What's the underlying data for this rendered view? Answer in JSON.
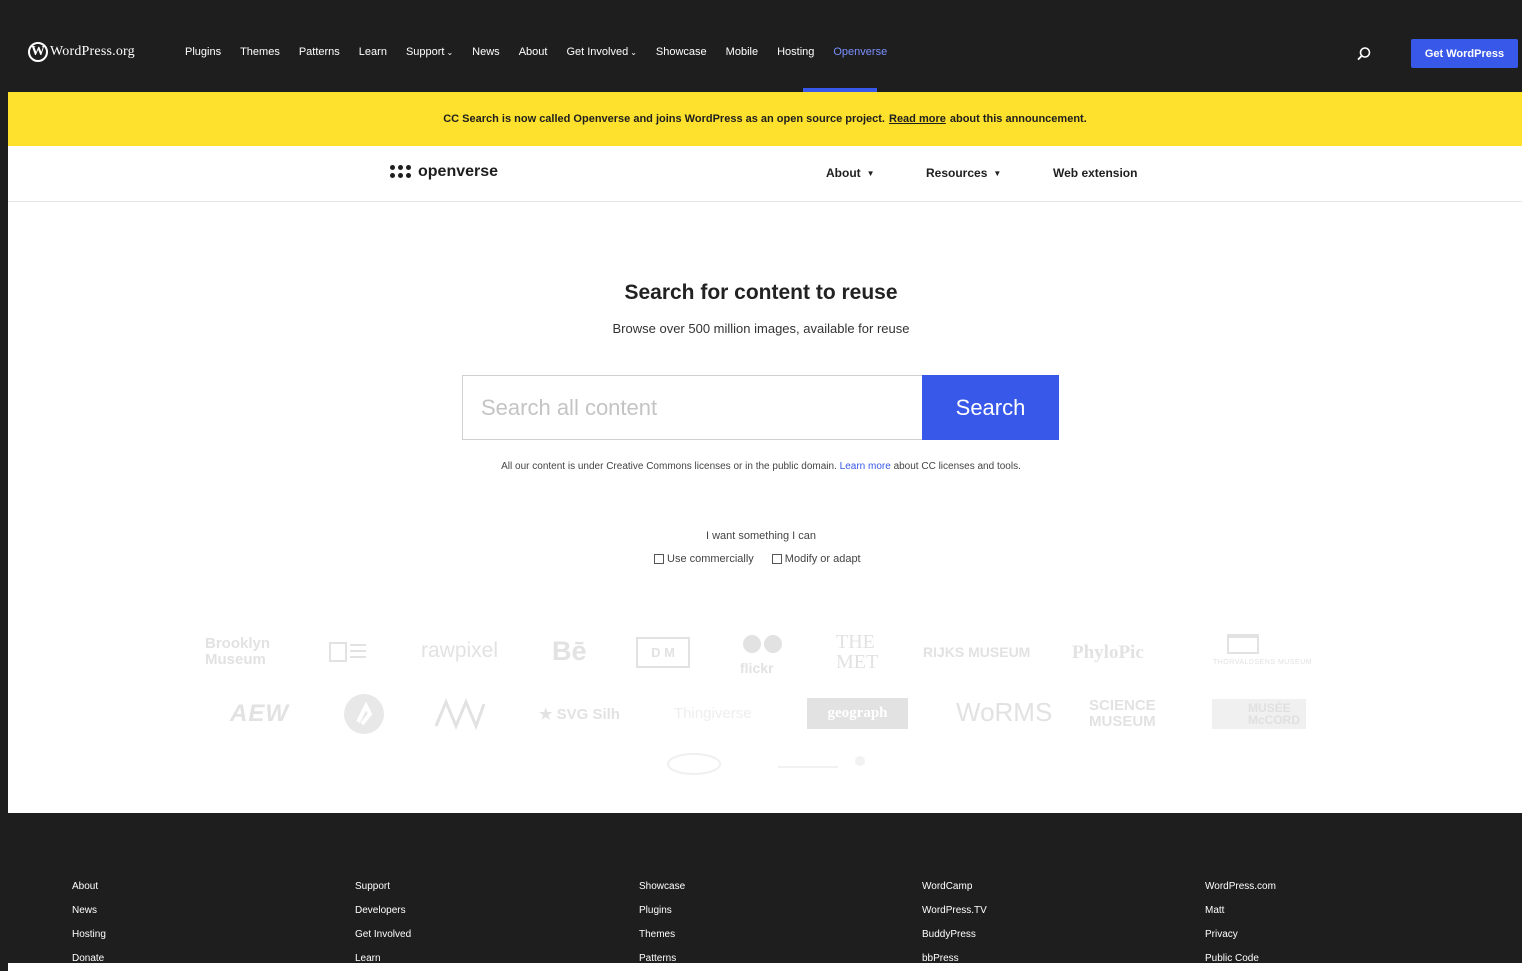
{
  "wp": {
    "logo_text": "WordPress.org",
    "nav": [
      {
        "label": "Plugins",
        "dropdown": false,
        "active": false
      },
      {
        "label": "Themes",
        "dropdown": false,
        "active": false
      },
      {
        "label": "Patterns",
        "dropdown": false,
        "active": false
      },
      {
        "label": "Learn",
        "dropdown": false,
        "active": false
      },
      {
        "label": "Support",
        "dropdown": true,
        "active": false
      },
      {
        "label": "News",
        "dropdown": false,
        "active": false
      },
      {
        "label": "About",
        "dropdown": false,
        "active": false
      },
      {
        "label": "Get Involved",
        "dropdown": true,
        "active": false
      },
      {
        "label": "Showcase",
        "dropdown": false,
        "active": false
      },
      {
        "label": "Mobile",
        "dropdown": false,
        "active": false
      },
      {
        "label": "Hosting",
        "dropdown": false,
        "active": false
      },
      {
        "label": "Openverse",
        "dropdown": false,
        "active": true
      }
    ],
    "get_button": "Get WordPress",
    "search_icon": "search-icon"
  },
  "banner": {
    "text_before": "CC Search is now called Openverse and joins WordPress as an open source project.",
    "link": "Read more",
    "text_after": "about this announcement."
  },
  "ov": {
    "logo_text": "openverse",
    "nav": [
      {
        "label": "About",
        "dropdown": true
      },
      {
        "label": "Resources",
        "dropdown": true
      },
      {
        "label": "Web extension",
        "dropdown": false
      }
    ]
  },
  "hero": {
    "title": "Search for content to reuse",
    "subtitle": "Browse over 500 million images, available for reuse",
    "search_placeholder": "Search all content",
    "search_button": "Search",
    "license_before": "All our content is under Creative Commons licenses or in the public domain.",
    "license_link": "Learn more",
    "license_after": "about CC licenses and tools.",
    "want_label": "I want something I can",
    "checkboxes": [
      "Use commercially",
      "Modify or adapt"
    ]
  },
  "sources": {
    "brooklyn": "Brooklyn\nMuseum",
    "rawpixel": "rawpixel",
    "behance": "Bē",
    "dm": "D M",
    "flickr": "flickr",
    "met": "THE\nMET",
    "rijks": "RIJKS MUSEUM",
    "phylopic": "PhyloPic",
    "thorvaldsens": "THORVALDSENS MUSEUM",
    "svg_silh": "★ SVG Silh",
    "thingiverse": "Thingiverse",
    "geograph": "geograph",
    "worms": "WoRMS",
    "science": "SCIENCE\nMUSEUM",
    "mccord": "MUSÉE\nMcCORD"
  },
  "footer": {
    "columns": [
      [
        "About",
        "News",
        "Hosting",
        "Donate"
      ],
      [
        "Support",
        "Developers",
        "Get Involved",
        "Learn"
      ],
      [
        "Showcase",
        "Plugins",
        "Themes",
        "Patterns"
      ],
      [
        "WordCamp",
        "WordPress.TV",
        "BuddyPress",
        "bbPress"
      ],
      [
        "WordPress.com",
        "Matt",
        "Privacy",
        "Public Code"
      ]
    ]
  },
  "colors": {
    "accent": "#3858e9",
    "banner": "#fde12d",
    "dark": "#1e1e1e"
  }
}
